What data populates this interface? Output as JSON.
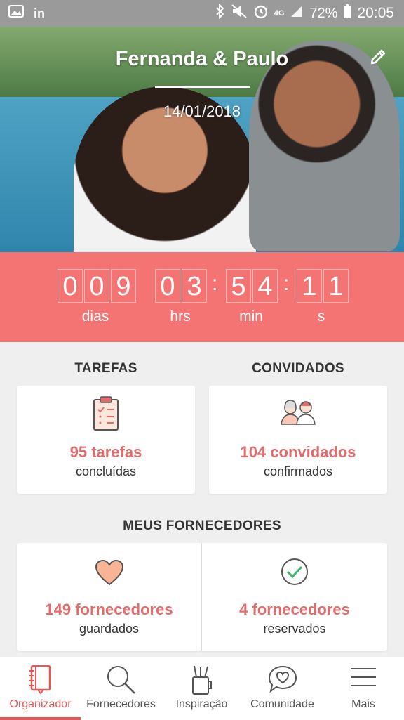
{
  "status_bar": {
    "battery": "72%",
    "time": "20:05",
    "network": "4G"
  },
  "hero": {
    "title": "Fernanda & Paulo",
    "date": "14/01/2018"
  },
  "countdown": {
    "days": [
      "0",
      "0",
      "9"
    ],
    "hours": [
      "0",
      "3"
    ],
    "minutes": [
      "5",
      "4"
    ],
    "seconds": [
      "1",
      "1"
    ],
    "labels": {
      "days": "dias",
      "hours": "hrs",
      "minutes": "min",
      "seconds": "s"
    }
  },
  "tasks": {
    "heading": "TAREFAS",
    "count": "95 tarefas",
    "sub": "concluídas"
  },
  "guests": {
    "heading": "CONVIDADOS",
    "count": "104 convidados",
    "sub": "confirmados"
  },
  "vendors": {
    "heading": "MEUS FORNECEDORES",
    "saved_count": "149 fornecedores",
    "saved_sub": "guardados",
    "booked_count": "4 fornecedores",
    "booked_sub": "reservados"
  },
  "nav": {
    "items": [
      {
        "label": "Organizador",
        "icon": "notebook-icon",
        "active": true
      },
      {
        "label": "Fornecedores",
        "icon": "search-icon",
        "active": false
      },
      {
        "label": "Inspiração",
        "icon": "pencil-cup-icon",
        "active": false
      },
      {
        "label": "Comunidade",
        "icon": "chat-heart-icon",
        "active": false
      },
      {
        "label": "Mais",
        "icon": "menu-icon",
        "active": false
      }
    ]
  },
  "colors": {
    "accent": "#f47474",
    "accent_text": "#e46b6b"
  }
}
